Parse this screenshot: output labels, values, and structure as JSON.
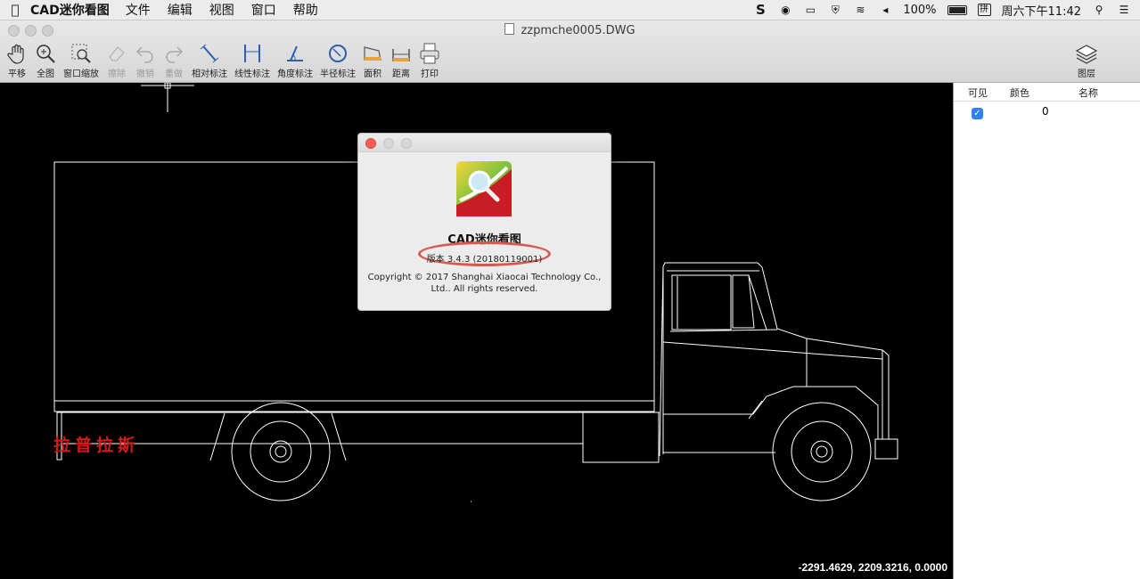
{
  "menubar": {
    "app_name": "CAD迷你看图",
    "menus": [
      "文件",
      "编辑",
      "视图",
      "窗口",
      "帮助"
    ],
    "battery": "100%",
    "clock": "周六下午11:42"
  },
  "window": {
    "title": "zzpmche0005.DWG"
  },
  "toolbar": {
    "tools": [
      {
        "label": "平移",
        "icon": "hand-icon",
        "enabled": true
      },
      {
        "label": "全图",
        "icon": "zoom-all-icon",
        "enabled": true
      },
      {
        "label": "窗口缩放",
        "icon": "window-zoom-icon",
        "enabled": true
      },
      {
        "label": "擦除",
        "icon": "eraser-icon",
        "enabled": false
      },
      {
        "label": "撤销",
        "icon": "undo-icon",
        "enabled": false
      },
      {
        "label": "重做",
        "icon": "redo-icon",
        "enabled": false
      },
      {
        "label": "相对标注",
        "icon": "relative-dimension-icon",
        "enabled": true
      },
      {
        "label": "线性标注",
        "icon": "linear-dimension-icon",
        "enabled": true
      },
      {
        "label": "角度标注",
        "icon": "angle-dimension-icon",
        "enabled": true
      },
      {
        "label": "半径标注",
        "icon": "radius-dimension-icon",
        "enabled": true
      },
      {
        "label": "面积",
        "icon": "area-icon",
        "enabled": true
      },
      {
        "label": "距离",
        "icon": "distance-icon",
        "enabled": true
      },
      {
        "label": "打印",
        "icon": "printer-icon",
        "enabled": true
      }
    ],
    "layers_label": "图层"
  },
  "layers_panel": {
    "headers": {
      "visible": "可见",
      "color": "颜色",
      "name": "名称"
    },
    "rows": [
      {
        "visible": true,
        "name": "0"
      }
    ]
  },
  "canvas": {
    "coordinates": "-2291.4629, 2209.3216, 0.0000",
    "watermark": "拉普拉斯"
  },
  "about_dialog": {
    "app_name": "CAD迷你看图",
    "version": "版本 3.4.3 (20180119001)",
    "copyright": "Copyright © 2017 Shanghai Xiaocai Technology Co., Ltd.. All rights reserved."
  },
  "colors": {
    "canvas_bg": "#000000",
    "drawing_lines": "#ffffff",
    "watermark": "#d61a1a",
    "highlight_oval": "#d8584f",
    "checkbox": "#2f82f5"
  }
}
